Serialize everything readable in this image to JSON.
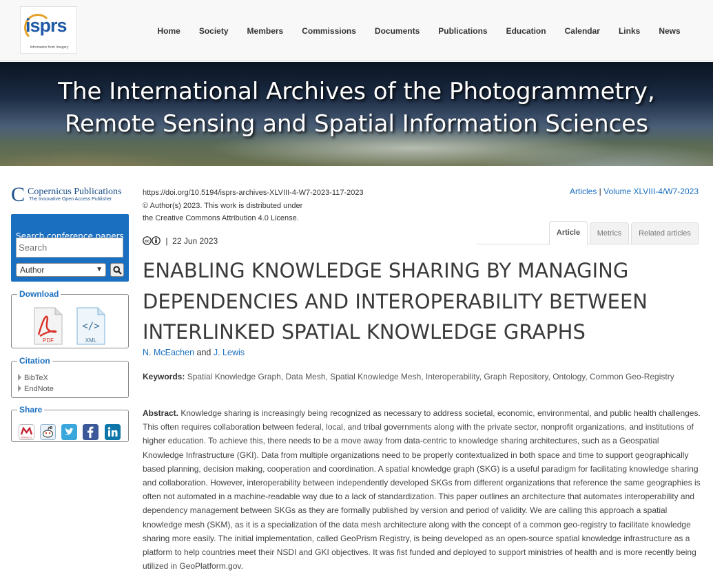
{
  "header": {
    "logo_text": "isprs",
    "logo_tagline": "Information from Imagery",
    "nav": [
      "Home",
      "Society",
      "Members",
      "Commissions",
      "Documents",
      "Publications",
      "Education",
      "Calendar",
      "Links",
      "News"
    ]
  },
  "banner": {
    "title": "The International Archives of the Photogrammetry, Remote Sensing and Spatial Information Sciences"
  },
  "sidebar": {
    "publisher_name": "Copernicus Publications",
    "publisher_tagline": "The Innovative Open Access Publisher",
    "search": {
      "title": "Search conference papers",
      "placeholder": "Search",
      "select_value": "Author"
    },
    "download": {
      "legend": "Download",
      "pdf_label": "PDF",
      "xml_label": "XML"
    },
    "citation": {
      "legend": "Citation",
      "items": [
        "BibTeX",
        "EndNote"
      ]
    },
    "share": {
      "legend": "Share",
      "mendeley_label": "MENDELEY"
    }
  },
  "article": {
    "doi": "https://doi.org/10.5194/isprs-archives-XLVIII-4-W7-2023-117-2023",
    "copyright_line1": "© Author(s) 2023. This work is distributed under",
    "copyright_line2": "the Creative Commons Attribution 4.0 License.",
    "links": {
      "articles": "Articles",
      "separator": "|",
      "volume": "Volume XLVIII-4/W7-2023"
    },
    "tabs": {
      "article": "Article",
      "metrics": "Metrics",
      "related": "Related articles"
    },
    "date": "22 Jun 2023",
    "date_separator": "|",
    "title": "ENABLING KNOWLEDGE SHARING BY MANAGING DEPENDENCIES AND INTEROPERABILITY BETWEEN INTERLINKED SPATIAL KNOWLEDGE GRAPHS",
    "author1": "N. McEachen",
    "author_and": "and",
    "author2": "J. Lewis",
    "keywords_label": "Keywords:",
    "keywords": "Spatial Knowledge Graph, Data Mesh, Spatial Knowledge Mesh, Interoperability, Graph Repository, Ontology, Common Geo-Registry",
    "abstract_label": "Abstract.",
    "abstract": "Knowledge sharing is increasingly being recognized as necessary to address societal, economic, environmental, and public health challenges. This often requires collaboration between federal, local, and tribal governments along with the private sector, nonprofit organizations, and institutions of higher education. To achieve this, there needs to be a move away from data-centric to knowledge sharing architectures, such as a Geospatial Knowledge Infrastructure (GKI). Data from multiple organizations need to be properly contextualized in both space and time to support geographically based planning, decision making, cooperation and coordination. A spatial knowledge graph (SKG) is a useful paradigm for facilitating knowledge sharing and collaboration. However, interoperability between independently developed SKGs from different organizations that reference the same geographies is often not automated in a machine-readable way due to a lack of standardization. This paper outlines an architecture that automates interoperability and dependency management between SKGs as they are formally published by version and period of validity. We are calling this approach a spatial knowledge mesh (SKM), as it is a specialization of the data mesh architecture along with the concept of a common geo-registry to facilitate knowledge sharing more easily. The initial implementation, called GeoPrism Registry, is being developed as an open-source spatial knowledge infrastructure as a platform to help countries meet their NSDI and GKI objectives. It was fist funded and deployed to support ministries of health and is more recently being utilized in GeoPlatform.gov."
  },
  "colors": {
    "link": "#1a6fc0",
    "search_panel": "#1a6fc0",
    "twitter": "#3aa7dc",
    "facebook": "#3b5998",
    "linkedin": "#0e76a8",
    "pdf": "#d9342b"
  }
}
